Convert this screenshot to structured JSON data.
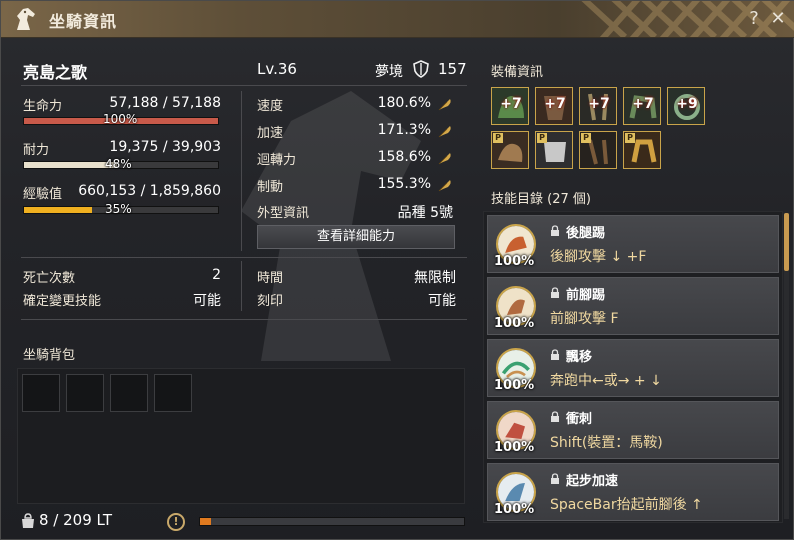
{
  "window": {
    "title": "坐騎資訊",
    "help_label": "?",
    "close_label": "✕"
  },
  "mount": {
    "name": "亮島之歌",
    "level": "Lv.36",
    "dream_label": "夢境",
    "dream_value": "157"
  },
  "stats": {
    "hp": {
      "label": "生命力",
      "value": "57,188 / 57,188",
      "percent_label": "100%",
      "fill": 1.0,
      "color": "#c85a4a"
    },
    "stamina": {
      "label": "耐力",
      "value": "19,375 / 39,903",
      "percent_label": "48%",
      "fill": 0.48,
      "color": "#e8e0cc"
    },
    "exp": {
      "label": "經驗值",
      "value": "660,153 / 1,859,860",
      "percent_label": "35%",
      "fill": 0.35,
      "color": "#f0b020"
    }
  },
  "attributes": [
    {
      "label": "速度",
      "value": "180.6%"
    },
    {
      "label": "加速",
      "value": "171.3%"
    },
    {
      "label": "迴轉力",
      "value": "158.6%"
    },
    {
      "label": "制動",
      "value": "155.3%"
    }
  ],
  "appearance": {
    "label": "外型資訊",
    "value": "品種 5號"
  },
  "detail_button": "查看詳細能力",
  "info": {
    "death_label": "死亡次數",
    "death_value": "2",
    "skill_change_label": "確定變更技能",
    "skill_change_value": "可能",
    "time_label": "時間",
    "time_value": "無限制",
    "imprint_label": "刻印",
    "imprint_value": "可能"
  },
  "bag": {
    "title": "坐騎背包",
    "weight": "8 / 209 LT",
    "weight_fill": 0.04
  },
  "equipment": {
    "title": "裝備資訊",
    "enhanced": [
      "+7",
      "+7",
      "+7",
      "+7",
      "+9"
    ],
    "p_badge": "P"
  },
  "skills": {
    "title": "技能目錄 (27 個)",
    "items": [
      {
        "name": "後腿踢",
        "command": "後腳攻擊 ↓ +F",
        "percent": "100%"
      },
      {
        "name": "前腳踢",
        "command": "前腳攻擊 F",
        "percent": "100%"
      },
      {
        "name": "飄移",
        "command": "奔跑中←或→ + ↓",
        "percent": "100%"
      },
      {
        "name": "衝刺",
        "command": "Shift(裝置：馬鞍)",
        "percent": "100%"
      },
      {
        "name": "起步加速",
        "command": "SpaceBar抬起前腳後 ↑",
        "percent": "100%"
      }
    ]
  },
  "colors": {
    "accent": "#c9a44a",
    "feather": "#d4a84a"
  }
}
